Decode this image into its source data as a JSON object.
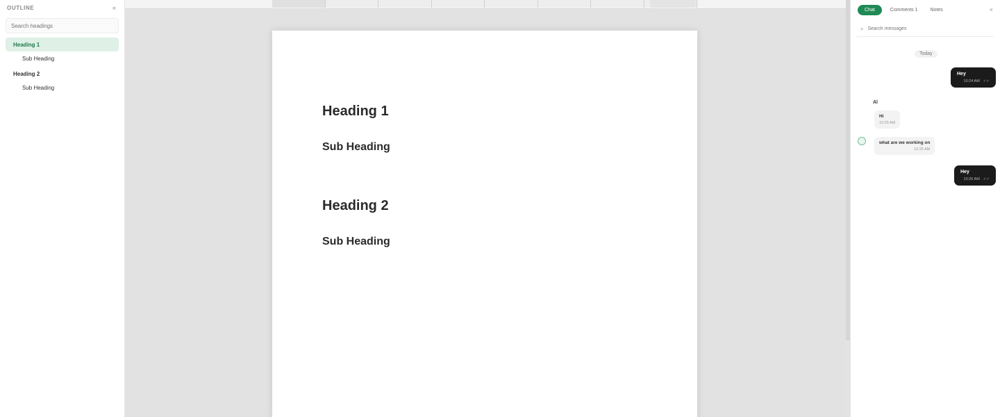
{
  "outline": {
    "title": "OUTLINE",
    "collapse_icon": "«",
    "search_placeholder": "Search headings",
    "items": [
      {
        "label": "Heading 1",
        "level": 1,
        "active": true
      },
      {
        "label": "Sub Heading",
        "level": 2
      },
      {
        "label": "Heading 2",
        "level": 1
      },
      {
        "label": "Sub Heading",
        "level": 2
      }
    ]
  },
  "document": {
    "heading1": "Heading 1",
    "sub1": "Sub Heading",
    "heading2": "Heading 2",
    "sub2": "Sub Heading"
  },
  "chat": {
    "tabs": {
      "active": "Chat",
      "second": "Comments 1",
      "third": "Notes"
    },
    "close_icon": "×",
    "search_icon": "⌕",
    "search_placeholder": "Search messages",
    "date_chip": "Today",
    "out1": {
      "text": "Hey",
      "time": "10:24 AM",
      "status": "✓✓"
    },
    "sender": "Al",
    "in1": {
      "text": "Hi",
      "time": "10:25 AM"
    },
    "in2": {
      "text": "what are we working on",
      "time": "10:25 AM"
    },
    "out2": {
      "text": "Hey",
      "time": "10:26 AM",
      "status": "✓✓"
    }
  },
  "colors": {
    "accent": "#1f8a55",
    "active_bg": "#dff0e6",
    "bubble_dark": "#1b1b1b"
  }
}
